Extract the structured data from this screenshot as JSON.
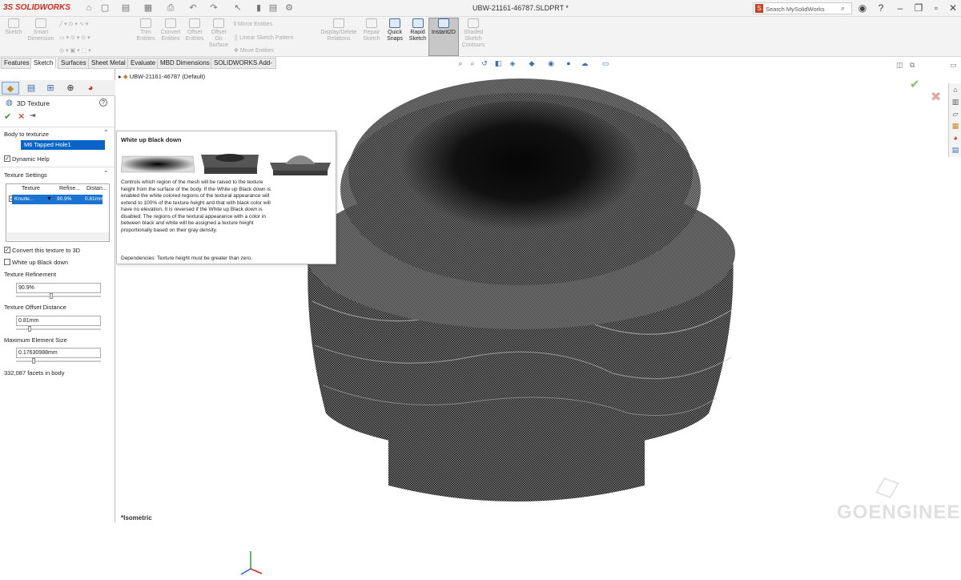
{
  "titlebar": {
    "logo": "3S SOLIDWORKS",
    "document_title": "UBW-21161-46787.SLDPRT *",
    "search_placeholder": "Search MySolidWorks"
  },
  "ribbon": {
    "items": [
      {
        "label": "Sketch",
        "enabled": false
      },
      {
        "label": "Smart\nDimension",
        "enabled": false
      },
      {
        "label": "Trim\nEntities",
        "enabled": false
      },
      {
        "label": "Convert\nEntities",
        "enabled": false
      },
      {
        "label": "Offset\nEntities",
        "enabled": false
      },
      {
        "label": "Offset\nOn\nSurface",
        "enabled": false
      },
      {
        "label": "Display/Delete\nRelations",
        "enabled": false
      },
      {
        "label": "Repair\nSketch",
        "enabled": false
      },
      {
        "label": "Quick\nSnaps",
        "enabled": true
      },
      {
        "label": "Rapid\nSketch",
        "enabled": true
      },
      {
        "label": "Instant2D",
        "enabled": true
      },
      {
        "label": "Shaded\nSketch\nContours",
        "enabled": false
      }
    ],
    "mirror_entities": "Mirror Entities",
    "linear_pattern": "Linear Sketch Pattern",
    "move_entities": "Move Entities"
  },
  "command_tabs": [
    "Features",
    "Sketch",
    "Surfaces",
    "Sheet Metal",
    "Evaluate",
    "MBD Dimensions",
    "SOLIDWORKS Add-Ins"
  ],
  "active_tab": "Sketch",
  "property_manager": {
    "title": "3D Texture",
    "body_section": "Body to texturize",
    "body_value": "M6 Tapped Hole1",
    "dynamic_help_label": "Dynamic Help",
    "texture_section": "Texture Settings",
    "table_headers": [
      "Texture",
      "Refine...",
      "Distan..."
    ],
    "table_row": [
      "Knurle...",
      "90.9%",
      "0.81mm"
    ],
    "convert_label": "Convert this texture to 3D",
    "white_up_label": "White up Black down",
    "refinement_label": "Texture Refinement",
    "refinement_value": "90.9%",
    "refinement_slider": 0.42,
    "offset_label": "Texture Offset Distance",
    "offset_value": "0.81mm",
    "offset_slider": 0.15,
    "max_element_label": "Maximum Element Size",
    "max_element_value": "0.17630988mm",
    "max_element_slider": 0.2,
    "facets_info": "332,087 facets in body"
  },
  "tree": {
    "part_name": "UBW-21161-46787 (Default)"
  },
  "tooltip": {
    "title": "White up Black down",
    "body": "Controls which region of the mesh will be raised to the texture height from the surface of the body. If the White up Black down is enabled the white colored regions of the textural appearance will extend to 100% of the texture height and that with black color will have no elevation. It is reversed if the White up Black down is disabled. The regions of the textural appearance with a color in between black and white will be assigned a texture height proportionally based on their gray density.",
    "dependencies": "Dependencies: Texture height must be greater than zero."
  },
  "viewport": {
    "view_name": "*Isometric",
    "watermark": "GOENGINEER"
  },
  "colors": {
    "selection_blue": "#0a64c8",
    "brand_red": "#d52b1e",
    "mesh_dark": "#1a1a1a"
  }
}
